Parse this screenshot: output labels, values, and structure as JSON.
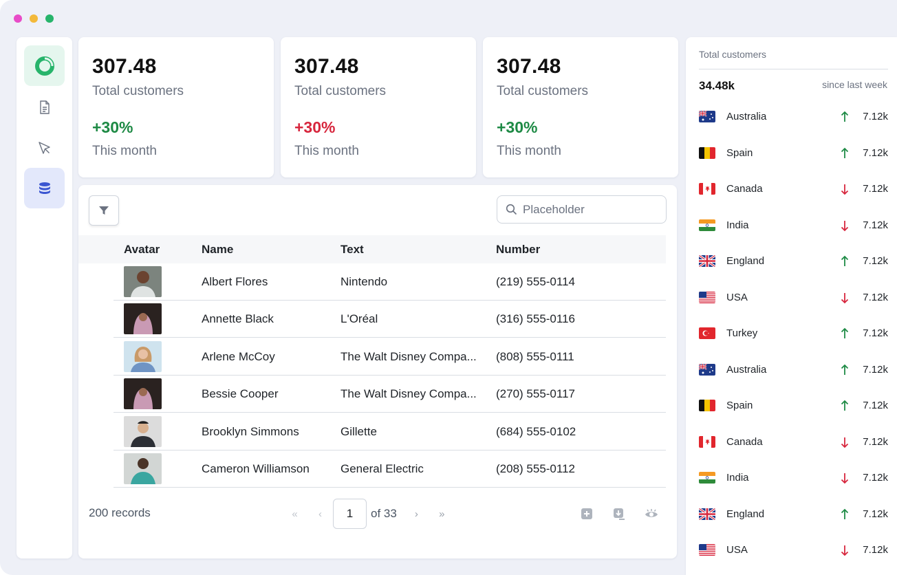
{
  "window": {
    "dot_colors": [
      "#e84cc8",
      "#f3b93b",
      "#27b46b"
    ]
  },
  "sidebar": {
    "items": [
      {
        "icon": "donut-chart-icon",
        "active_bg": "#e5f6ee",
        "color": "#27b46b"
      },
      {
        "icon": "document-icon"
      },
      {
        "icon": "cursor-icon"
      },
      {
        "icon": "database-icon",
        "active_bg": "#e3e8fb",
        "color": "#3b56d1"
      }
    ]
  },
  "stats": [
    {
      "value": "307.48",
      "label": "Total customers",
      "change": "+30%",
      "change_color": "#1e8a45",
      "period": "This month"
    },
    {
      "value": "307.48",
      "label": "Total customers",
      "change": "+30%",
      "change_color": "#d7263d",
      "period": "This month"
    },
    {
      "value": "307.48",
      "label": "Total customers",
      "change": "+30%",
      "change_color": "#1e8a45",
      "period": "This month"
    }
  ],
  "table": {
    "search_placeholder": "Placeholder",
    "columns": [
      "Avatar",
      "Name",
      "Text",
      "Number"
    ],
    "rows": [
      {
        "name": "Albert Flores",
        "text": "Nintendo",
        "number": "(219) 555-0114"
      },
      {
        "name": "Annette Black",
        "text": "L'Oréal",
        "number": "(316) 555-0116"
      },
      {
        "name": "Arlene McCoy",
        "text": "The Walt Disney Compa...",
        "number": "(808) 555-0111"
      },
      {
        "name": "Bessie Cooper",
        "text": "The Walt Disney Compa...",
        "number": "(270) 555-0117"
      },
      {
        "name": "Brooklyn Simmons",
        "text": "Gillette",
        "number": "(684) 555-0102"
      },
      {
        "name": "Cameron Williamson",
        "text": "General Electric",
        "number": "(208) 555-0112"
      }
    ],
    "records": "200 records",
    "pager": {
      "first": "«",
      "prev": "‹",
      "page": "1",
      "of": "of 33",
      "next": "›",
      "last": "»"
    }
  },
  "panel": {
    "title": "Total customers",
    "total": "34.48k",
    "since": "since last week",
    "up_color": "#1e8a45",
    "down_color": "#d7263d",
    "countries": [
      {
        "name": "Australia",
        "flag": "australia",
        "trend": "up",
        "value": "7.12k"
      },
      {
        "name": "Spain",
        "flag": "belgium-like",
        "trend": "up",
        "value": "7.12k"
      },
      {
        "name": "Canada",
        "flag": "canada",
        "trend": "down",
        "value": "7.12k"
      },
      {
        "name": "India",
        "flag": "india",
        "trend": "down",
        "value": "7.12k"
      },
      {
        "name": "England",
        "flag": "uk",
        "trend": "up",
        "value": "7.12k"
      },
      {
        "name": "USA",
        "flag": "usa",
        "trend": "down",
        "value": "7.12k"
      },
      {
        "name": "Turkey",
        "flag": "turkey",
        "trend": "up",
        "value": "7.12k"
      },
      {
        "name": "Australia",
        "flag": "australia",
        "trend": "up",
        "value": "7.12k"
      },
      {
        "name": "Spain",
        "flag": "belgium-like",
        "trend": "up",
        "value": "7.12k"
      },
      {
        "name": "Canada",
        "flag": "canada",
        "trend": "down",
        "value": "7.12k"
      },
      {
        "name": "India",
        "flag": "india",
        "trend": "down",
        "value": "7.12k"
      },
      {
        "name": "England",
        "flag": "uk",
        "trend": "up",
        "value": "7.12k"
      },
      {
        "name": "USA",
        "flag": "usa",
        "trend": "down",
        "value": "7.12k"
      }
    ]
  }
}
